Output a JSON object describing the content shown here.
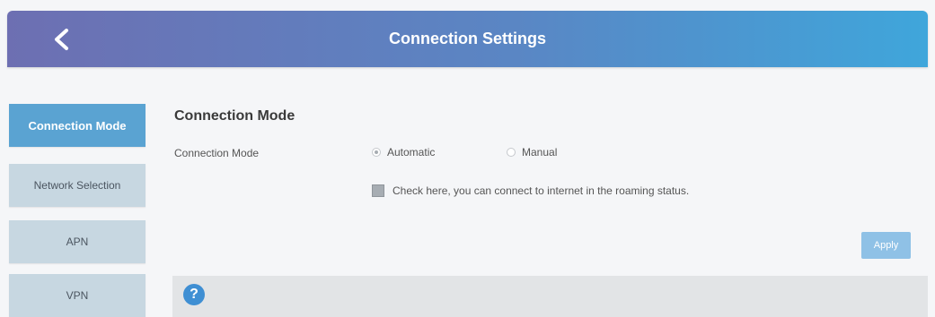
{
  "header": {
    "title": "Connection Settings",
    "back_icon": "chevron-left-icon"
  },
  "sidebar": {
    "items": [
      {
        "label": "Connection Mode",
        "active": true
      },
      {
        "label": "Network Selection",
        "active": false
      },
      {
        "label": "APN",
        "active": false
      },
      {
        "label": "VPN",
        "active": false
      }
    ]
  },
  "main": {
    "section_title": "Connection Mode",
    "field_label": "Connection Mode",
    "options": [
      {
        "label": "Automatic",
        "selected": true
      },
      {
        "label": "Manual",
        "selected": false
      }
    ],
    "roaming_checkbox": {
      "label": "Check here, you can connect to internet in the roaming status.",
      "checked": true
    },
    "apply_label": "Apply"
  },
  "help": {
    "icon": "help-icon",
    "glyph": "?"
  },
  "colors": {
    "header_start": "#6d6fb2",
    "header_end": "#3fa6db",
    "sidebar_active": "#5aa3d2",
    "sidebar_inactive": "#c7d7e1",
    "apply_button": "#8fc1e6",
    "help_icon": "#3f8fd3"
  }
}
